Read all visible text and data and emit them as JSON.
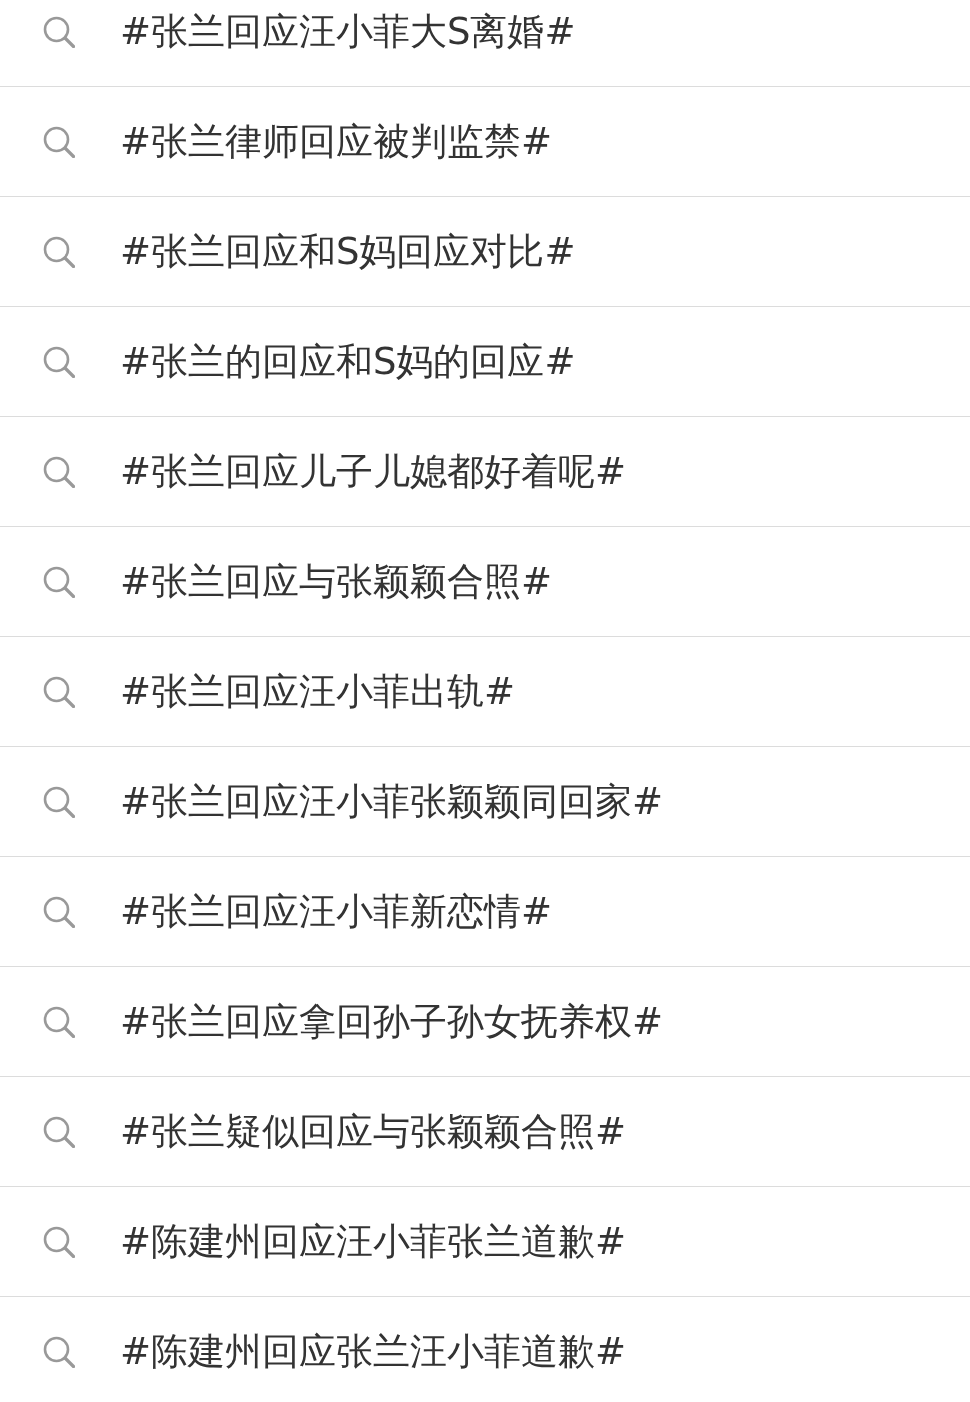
{
  "suggestions": [
    {
      "text": "#张兰回应汪小菲大S离婚#"
    },
    {
      "text": "#张兰律师回应被判监禁#"
    },
    {
      "text": "#张兰回应和S妈回应对比#"
    },
    {
      "text": "#张兰的回应和S妈的回应#"
    },
    {
      "text": "#张兰回应儿子儿媳都好着呢#"
    },
    {
      "text": "#张兰回应与张颖颖合照#"
    },
    {
      "text": "#张兰回应汪小菲出轨#"
    },
    {
      "text": "#张兰回应汪小菲张颖颖同回家#"
    },
    {
      "text": "#张兰回应汪小菲新恋情#"
    },
    {
      "text": "#张兰回应拿回孙子孙女抚养权#"
    },
    {
      "text": "#张兰疑似回应与张颖颖合照#"
    },
    {
      "text": "#陈建州回应汪小菲张兰道歉#"
    },
    {
      "text": "#陈建州回应张兰汪小菲道歉#"
    }
  ]
}
